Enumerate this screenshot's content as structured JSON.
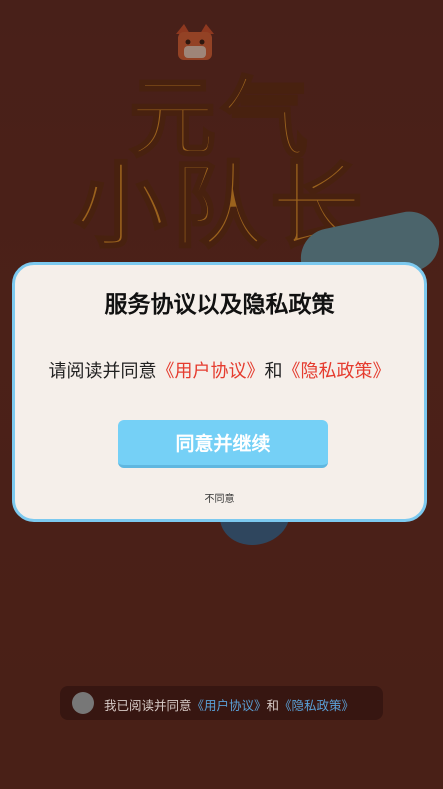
{
  "logo": {
    "title_line1": "元气",
    "title_line2": "小队长"
  },
  "dialog": {
    "title": "服务协议以及隐私政策",
    "text_prefix": "请阅读并同意",
    "user_agreement": "《用户协议》",
    "and": "和",
    "privacy_policy": "《隐私政策》",
    "agree_button": "同意并继续",
    "disagree_link": "不同意"
  },
  "agreement_bar": {
    "text_prefix": "我已阅读并同意",
    "user_agreement": "《用户协议》",
    "and": "和",
    "privacy_policy": "《隐私政策》"
  },
  "colors": {
    "background": "#5a2a23",
    "dialog_bg": "#f5efea",
    "dialog_border": "#7cc9ef",
    "button": "#75d0f6",
    "link_red": "#e53b2e",
    "link_blue": "#5aa0d6"
  }
}
